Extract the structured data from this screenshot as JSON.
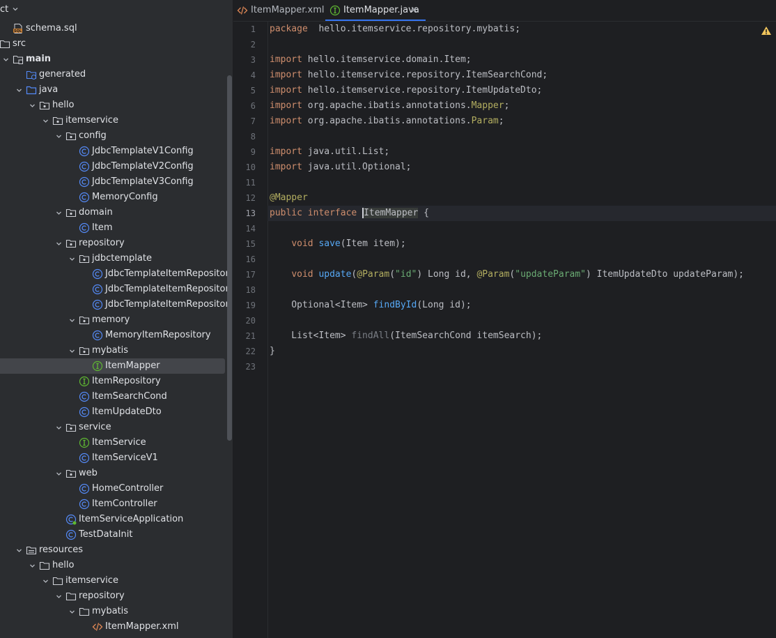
{
  "project": {
    "title": "ct",
    "tree": [
      {
        "depth": 1,
        "arrow": "none",
        "icon": "sql-file-icon",
        "label": "schema.sql",
        "bold": false
      },
      {
        "depth": 0,
        "arrow": "right",
        "icon": "folder-icon",
        "label": "src",
        "bold": false
      },
      {
        "depth": 1,
        "arrow": "down",
        "icon": "module-folder-icon",
        "label": "main",
        "bold": true
      },
      {
        "depth": 2,
        "arrow": "none",
        "icon": "generated-folder-icon",
        "label": "generated",
        "bold": false
      },
      {
        "depth": 2,
        "arrow": "down",
        "icon": "source-folder-icon",
        "label": "java",
        "bold": false
      },
      {
        "depth": 3,
        "arrow": "down",
        "icon": "package-icon",
        "label": "hello",
        "bold": false
      },
      {
        "depth": 4,
        "arrow": "down",
        "icon": "package-icon",
        "label": "itemservice",
        "bold": false
      },
      {
        "depth": 5,
        "arrow": "down",
        "icon": "package-icon",
        "label": "config",
        "bold": false
      },
      {
        "depth": 6,
        "arrow": "none",
        "icon": "class-icon",
        "label": "JdbcTemplateV1Config",
        "bold": false
      },
      {
        "depth": 6,
        "arrow": "none",
        "icon": "class-icon",
        "label": "JdbcTemplateV2Config",
        "bold": false
      },
      {
        "depth": 6,
        "arrow": "none",
        "icon": "class-icon",
        "label": "JdbcTemplateV3Config",
        "bold": false
      },
      {
        "depth": 6,
        "arrow": "none",
        "icon": "class-icon",
        "label": "MemoryConfig",
        "bold": false
      },
      {
        "depth": 5,
        "arrow": "down",
        "icon": "package-icon",
        "label": "domain",
        "bold": false
      },
      {
        "depth": 6,
        "arrow": "none",
        "icon": "class-icon",
        "label": "Item",
        "bold": false
      },
      {
        "depth": 5,
        "arrow": "down",
        "icon": "package-icon",
        "label": "repository",
        "bold": false
      },
      {
        "depth": 6,
        "arrow": "down",
        "icon": "package-icon",
        "label": "jdbctemplate",
        "bold": false
      },
      {
        "depth": 7,
        "arrow": "none",
        "icon": "class-icon",
        "label": "JdbcTemplateItemRepositor",
        "bold": false
      },
      {
        "depth": 7,
        "arrow": "none",
        "icon": "class-icon",
        "label": "JdbcTemplateItemRepositor",
        "bold": false
      },
      {
        "depth": 7,
        "arrow": "none",
        "icon": "class-icon",
        "label": "JdbcTemplateItemRepositor",
        "bold": false
      },
      {
        "depth": 6,
        "arrow": "down",
        "icon": "package-icon",
        "label": "memory",
        "bold": false
      },
      {
        "depth": 7,
        "arrow": "none",
        "icon": "class-icon",
        "label": "MemoryItemRepository",
        "bold": false
      },
      {
        "depth": 6,
        "arrow": "down",
        "icon": "package-icon",
        "label": "mybatis",
        "bold": false
      },
      {
        "depth": 7,
        "arrow": "none",
        "icon": "interface-icon",
        "label": "ItemMapper",
        "bold": false,
        "selected": true
      },
      {
        "depth": 6,
        "arrow": "none",
        "icon": "interface-icon",
        "label": "ItemRepository",
        "bold": false
      },
      {
        "depth": 6,
        "arrow": "none",
        "icon": "class-icon",
        "label": "ItemSearchCond",
        "bold": false
      },
      {
        "depth": 6,
        "arrow": "none",
        "icon": "class-icon",
        "label": "ItemUpdateDto",
        "bold": false
      },
      {
        "depth": 5,
        "arrow": "down",
        "icon": "package-icon",
        "label": "service",
        "bold": false
      },
      {
        "depth": 6,
        "arrow": "none",
        "icon": "interface-icon",
        "label": "ItemService",
        "bold": false
      },
      {
        "depth": 6,
        "arrow": "none",
        "icon": "class-icon",
        "label": "ItemServiceV1",
        "bold": false
      },
      {
        "depth": 5,
        "arrow": "down",
        "icon": "package-icon",
        "label": "web",
        "bold": false
      },
      {
        "depth": 6,
        "arrow": "none",
        "icon": "class-icon",
        "label": "HomeController",
        "bold": false
      },
      {
        "depth": 6,
        "arrow": "none",
        "icon": "class-icon",
        "label": "ItemController",
        "bold": false
      },
      {
        "depth": 5,
        "arrow": "none",
        "icon": "spring-class-icon",
        "label": "ItemServiceApplication",
        "bold": false
      },
      {
        "depth": 5,
        "arrow": "none",
        "icon": "class-icon",
        "label": "TestDataInit",
        "bold": false
      },
      {
        "depth": 2,
        "arrow": "down",
        "icon": "resources-folder-icon",
        "label": "resources",
        "bold": false
      },
      {
        "depth": 3,
        "arrow": "down",
        "icon": "folder-icon",
        "label": "hello",
        "bold": false
      },
      {
        "depth": 4,
        "arrow": "down",
        "icon": "folder-icon",
        "label": "itemservice",
        "bold": false
      },
      {
        "depth": 5,
        "arrow": "down",
        "icon": "folder-icon",
        "label": "repository",
        "bold": false
      },
      {
        "depth": 6,
        "arrow": "down",
        "icon": "folder-icon",
        "label": "mybatis",
        "bold": false
      },
      {
        "depth": 7,
        "arrow": "none",
        "icon": "xml-file-icon",
        "label": "ItemMapper.xml",
        "bold": false
      }
    ]
  },
  "editor": {
    "tabs": [
      {
        "label": "ItemMapper.xml",
        "icon": "xml-file-icon",
        "active": false
      },
      {
        "label": "ItemMapper.java",
        "icon": "interface-icon",
        "active": true,
        "close": "×"
      }
    ],
    "current_line": 13,
    "lines": [
      [
        [
          "kw",
          "package"
        ],
        [
          "",
          "  hello.itemservice.repository.mybatis;"
        ]
      ],
      [],
      [
        [
          "kw",
          "import"
        ],
        [
          "",
          " hello.itemservice.domain.Item;"
        ]
      ],
      [
        [
          "kw",
          "import"
        ],
        [
          "",
          " hello.itemservice.repository.ItemSearchCond;"
        ]
      ],
      [
        [
          "kw",
          "import"
        ],
        [
          "",
          " hello.itemservice.repository.ItemUpdateDto;"
        ]
      ],
      [
        [
          "kw",
          "import"
        ],
        [
          "",
          " org.apache.ibatis.annotations."
        ],
        [
          "an",
          "Mapper"
        ],
        [
          "",
          ";"
        ]
      ],
      [
        [
          "kw",
          "import"
        ],
        [
          "",
          " org.apache.ibatis.annotations."
        ],
        [
          "an",
          "Param"
        ],
        [
          "",
          ";"
        ]
      ],
      [],
      [
        [
          "kw",
          "import"
        ],
        [
          "",
          " java.util.List;"
        ]
      ],
      [
        [
          "kw",
          "import"
        ],
        [
          "",
          " java.util.Optional;"
        ]
      ],
      [],
      [
        [
          "an",
          "@Mapper"
        ]
      ],
      [
        [
          "kw",
          "public interface "
        ],
        [
          "caret",
          ""
        ],
        [
          "hl",
          "ItemMapper"
        ],
        [
          "",
          " {"
        ]
      ],
      [],
      [
        [
          "",
          "    "
        ],
        [
          "kw",
          "void "
        ],
        [
          "fn",
          "save"
        ],
        [
          "",
          "(Item item);"
        ]
      ],
      [],
      [
        [
          "",
          "    "
        ],
        [
          "kw",
          "void "
        ],
        [
          "fn",
          "update"
        ],
        [
          "",
          "("
        ],
        [
          "an",
          "@Param"
        ],
        [
          "",
          "("
        ],
        [
          "st",
          "\"id\""
        ],
        [
          "",
          ") Long id, "
        ],
        [
          "an",
          "@Param"
        ],
        [
          "",
          "("
        ],
        [
          "st",
          "\"updateParam\""
        ],
        [
          "",
          ") ItemUpdateDto updateParam);"
        ]
      ],
      [],
      [
        [
          "",
          "    Optional<Item> "
        ],
        [
          "fn",
          "findById"
        ],
        [
          "",
          "(Long id);"
        ]
      ],
      [],
      [
        [
          "",
          "    List<Item> "
        ],
        [
          "fnd",
          "findAll"
        ],
        [
          "",
          "(ItemSearchCond itemSearch);"
        ]
      ],
      [
        [
          "",
          "}"
        ]
      ],
      []
    ]
  }
}
